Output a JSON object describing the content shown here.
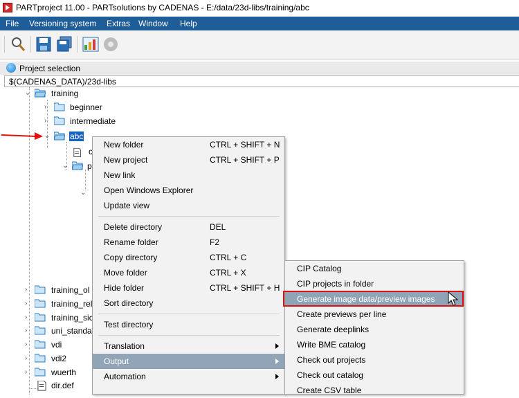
{
  "window": {
    "title": "PARTproject 11.00 - PARTsolutions by CADENAS - E:/data/23d-libs/training/abc"
  },
  "menubar": {
    "items": [
      "File",
      "Versioning system",
      "Extras",
      "Window",
      "Help"
    ]
  },
  "toolbar": {
    "icons": [
      "search-icon",
      "save-icon",
      "save-all-icon",
      "dashboard-icon",
      "disc-icon"
    ]
  },
  "panel": {
    "title": "Project selection",
    "path": "$(CADENAS_DATA)/23d-libs"
  },
  "tree": {
    "nodes": [
      {
        "label": "training",
        "expanded": true
      },
      {
        "label": "beginner",
        "expanded": false
      },
      {
        "label": "intermediate",
        "expanded": false
      },
      {
        "label": "abc",
        "expanded": true,
        "selected": true
      },
      {
        "label": "c",
        "type": "file"
      },
      {
        "label": "p",
        "expanded": true
      },
      {
        "label": "training_ol"
      },
      {
        "label": "training_rel"
      },
      {
        "label": "training_sic"
      },
      {
        "label": "uni_standa"
      },
      {
        "label": "vdi"
      },
      {
        "label": "vdi2"
      },
      {
        "label": "wuerth"
      },
      {
        "label": "dir.def",
        "type": "file"
      }
    ]
  },
  "context_menu": {
    "items": [
      {
        "label": "New folder",
        "shortcut": "CTRL + SHIFT + N"
      },
      {
        "label": "New project",
        "shortcut": "CTRL + SHIFT + P"
      },
      {
        "label": "New link",
        "shortcut": ""
      },
      {
        "label": "Open Windows Explorer",
        "shortcut": ""
      },
      {
        "label": "Update view",
        "shortcut": ""
      },
      {
        "label": "Delete directory",
        "shortcut": "DEL"
      },
      {
        "label": "Rename folder",
        "shortcut": "F2"
      },
      {
        "label": "Copy directory",
        "shortcut": "CTRL + C"
      },
      {
        "label": "Move folder",
        "shortcut": "CTRL + X"
      },
      {
        "label": "Hide folder",
        "shortcut": "CTRL + SHIFT + H"
      },
      {
        "label": "Sort directory",
        "shortcut": ""
      },
      {
        "label": "Test directory",
        "shortcut": ""
      },
      {
        "label": "Translation",
        "shortcut": ""
      },
      {
        "label": "Output",
        "shortcut": ""
      },
      {
        "label": "Automation",
        "shortcut": ""
      }
    ],
    "highlighted": "Output"
  },
  "submenu": {
    "items": [
      "CIP Catalog",
      "CIP projects in folder",
      "Generate image data/preview images",
      "Create previews per line",
      "Generate deeplinks",
      "Write BME catalog",
      "Check out projects",
      "Check out catalog",
      "Create CSV table"
    ],
    "highlighted": "Generate image data/preview images"
  },
  "colors": {
    "menubar": "#1f5d99",
    "selection": "#1565c0",
    "menu_highlight": "#91a5b7",
    "callout": "#e01010"
  }
}
